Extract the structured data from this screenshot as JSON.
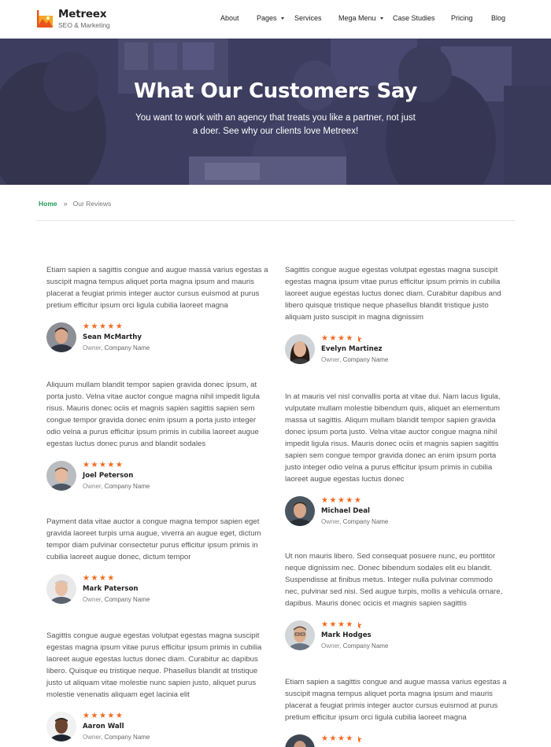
{
  "brand": {
    "name": "Metreex",
    "tagline": "SEO & Marketing"
  },
  "nav": [
    {
      "label": "About",
      "dropdown": false
    },
    {
      "label": "Pages",
      "dropdown": true
    },
    {
      "label": "Services",
      "dropdown": false
    },
    {
      "label": "Mega Menu",
      "dropdown": true
    },
    {
      "label": "Case Studies",
      "dropdown": false
    },
    {
      "label": "Pricing",
      "dropdown": false
    },
    {
      "label": "Blog",
      "dropdown": false
    }
  ],
  "hero": {
    "title": "What Our Customers Say",
    "subtitle": "You want to work with an agency that treats you like a partner, not just a doer. See why our clients love Metreex!"
  },
  "breadcrumb": {
    "home": "Home",
    "separator": "»",
    "current": "Our Reviews"
  },
  "reviews": [
    {
      "text": "Etiam sapien a sagittis congue and augue massa varius egestas a suscipit magna tempus aliquet porta magna ipsum and mauris placerat a feugiat primis integer auctor cursus euismod at purus pretium efficitur ipsum orci ligula cubilia laoreet magna",
      "name": "Sean McMarthy",
      "role": "Owner,",
      "company": "Company Name",
      "rating": 5
    },
    {
      "text": "Sagittis congue augue egestas volutpat egestas magna suscipit egestas magna ipsum vitae purus efficitur ipsum primis in cubilia laoreet augue egestas luctus donec diam. Curabitur dapibus and libero quisque tristique neque phasellus blandit tristique justo aliquam justo suscipit in magna dignissim",
      "name": "Evelyn Martinez",
      "role": "Owner,",
      "company": "Company Name",
      "rating": 4.5
    },
    {
      "text": "Aliquum mullam blandit tempor sapien gravida donec ipsum, at porta justo. Velna vitae auctor congue magna nihil impedit ligula risus. Mauris donec ociis et magnis sapien sagittis sapien sem congue tempor gravida donec enim ipsum a porta justo integer odio velna a purus efficitur ipsum primis in cubilia laoreet augue egestas luctus donec purus and blandit sodales",
      "name": "Joel Peterson",
      "role": "Owner,",
      "company": "Company Name",
      "rating": 5
    },
    {
      "text": "In at mauris vel nisl convallis porta at vitae dui. Nam lacus ligula, vulputate mullam molestie bibendum quis, aliquet an elementum massa ut sagittis. Aliqum mullam blandit tempor sapien gravida donec ipsum porta justo. Velna vitae auctor congue magna nihil impedit ligula risus. Mauris donec ociis et magnis sapien sagittis sapien sem congue tempor gravida donec an enim ipsum porta justo integer odio velna a purus efficitur ipsum primis in cubilia laoreet augue egestas luctus donec",
      "name": "Michael Deal",
      "role": "Owner,",
      "company": "Company Name",
      "rating": 5
    },
    {
      "text": "Payment data vitae auctor a congue magna tempor sapien eget gravida laoreet turpis urna augue, viverra an augue eget, dictum tempor diam pulvinar consectetur purus efficitur ipsum primis in cubilia laoreet augue donec, dictum tempor",
      "name": "Mark Paterson",
      "role": "Owner,",
      "company": "Company Name",
      "rating": 4
    },
    {
      "text": "Ut non mauris libero. Sed consequat posuere nunc, eu porttitor neque dignissim nec. Donec bibendum sodales elit eu blandit. Suspendisse at finibus metus. Integer nulla pulvinar commodo nec, pulvinar sed nisi. Sed augue turpis, mollis a vehicula ornare, dapibus. Mauris donec ocicis et magnis sapien sagittis",
      "name": "Mark Hodges",
      "role": "Owner,",
      "company": "Company Name",
      "rating": 4.5
    },
    {
      "text": "Sagittis congue augue egestas volutpat egestas magna suscipit egestas magna ipsum vitae purus efficitur ipsum primis in cubilia laoreet augue egestas luctus donec diam. Curabitur ac dapibus libero. Quisque eu tristique neque. Phasellus blandit at tristique justo ut aliquam vitae molestie nunc sapien justo, aliquet purus molestie venenatis aliquam eget lacinia elit",
      "name": "Aaron Wall",
      "role": "Owner,",
      "company": "Company Name",
      "rating": 5
    },
    {
      "text": "Etiam sapien a sagittis congue and augue massa varius egestas a suscipit magna tempus aliquet porta magna ipsum and mauris placerat a feugiat primis integer auctor cursus euismod at purus pretium efficitur ipsum orci ligula cubilia laoreet magna",
      "name": "",
      "role": "",
      "company": "",
      "rating": 4.5
    }
  ],
  "colors": {
    "star": "#f26b21",
    "breadcrumb_home": "#1f9d55",
    "hero_overlay": "#3d3d60"
  }
}
